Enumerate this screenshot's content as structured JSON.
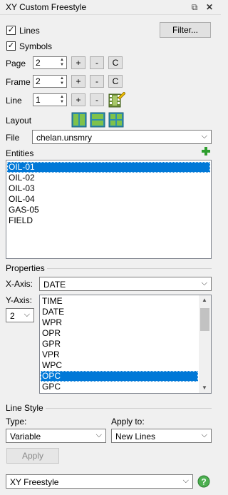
{
  "window": {
    "title": "XY Custom Freestyle"
  },
  "lines_label": "Lines",
  "symbols_label": "Symbols",
  "filter_button": "Filter...",
  "page": {
    "label": "Page",
    "value": "2"
  },
  "frame": {
    "label": "Frame",
    "value": "2"
  },
  "line": {
    "label": "Line",
    "value": "1"
  },
  "buttons": {
    "plus": "+",
    "minus": "-",
    "c": "C"
  },
  "layout_label": "Layout",
  "file": {
    "label": "File",
    "value": "chelan.unsmry"
  },
  "entities": {
    "label": "Entities",
    "items": [
      "OIL-01",
      "OIL-02",
      "OIL-03",
      "OIL-04",
      "GAS-05",
      "FIELD"
    ],
    "selected": "OIL-01"
  },
  "properties": {
    "label": "Properties",
    "xaxis_label": "X-Axis:",
    "xaxis_value": "DATE",
    "yaxis_label": "Y-Axis:",
    "yaxis_count": "2",
    "yaxis_items": [
      "TIME",
      "DATE",
      "WPR",
      "OPR",
      "GPR",
      "VPR",
      "WPC",
      "OPC",
      "GPC"
    ],
    "yaxis_selected": "OPC"
  },
  "line_style": {
    "label": "Line Style",
    "type_label": "Type:",
    "type_value": "Variable",
    "apply_to_label": "Apply to:",
    "apply_to_value": "New Lines",
    "apply_button": "Apply"
  },
  "bottom_combo": "XY Freestyle",
  "colors": {
    "accent": "#0078d7",
    "add_icon": "#2e9e2e",
    "help_icon": "#4caf50"
  }
}
